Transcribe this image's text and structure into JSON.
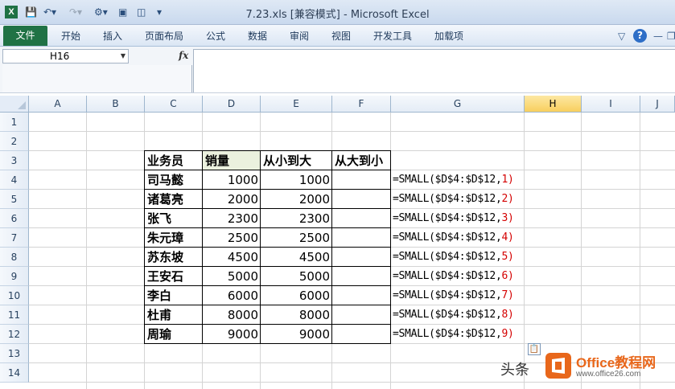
{
  "window": {
    "title": "7.23.xls  [兼容模式] - Microsoft Excel"
  },
  "ribbon": {
    "file_tab": "文件",
    "tabs": [
      "开始",
      "插入",
      "页面布局",
      "公式",
      "数据",
      "审阅",
      "视图",
      "开发工具",
      "加载项"
    ]
  },
  "formula_bar": {
    "name_box": "H16",
    "fx": "fx",
    "value": ""
  },
  "columns": [
    "A",
    "B",
    "C",
    "D",
    "E",
    "F",
    "G",
    "H",
    "I",
    "J"
  ],
  "active_column": "H",
  "rows": [
    "1",
    "2",
    "3",
    "4",
    "5",
    "6",
    "7",
    "8",
    "9",
    "10",
    "11",
    "12",
    "13",
    "14"
  ],
  "table": {
    "headers": [
      "业务员",
      "销量",
      "从小到大",
      "从大到小"
    ],
    "records": [
      {
        "name": "司马懿",
        "sales": "1000",
        "asc": "1000",
        "formula": "=SMALL($D$4:$D$12,",
        "arg": "1",
        "close": ")"
      },
      {
        "name": "诸葛亮",
        "sales": "2000",
        "asc": "2000",
        "formula": "=SMALL($D$4:$D$12,",
        "arg": "2",
        "close": ")"
      },
      {
        "name": "张飞",
        "sales": "2300",
        "asc": "2300",
        "formula": "=SMALL($D$4:$D$12,",
        "arg": "3",
        "close": ")"
      },
      {
        "name": "朱元璋",
        "sales": "2500",
        "asc": "2500",
        "formula": "=SMALL($D$4:$D$12,",
        "arg": "4",
        "close": ")"
      },
      {
        "name": "苏东坡",
        "sales": "4500",
        "asc": "4500",
        "formula": "=SMALL($D$4:$D$12,",
        "arg": "5",
        "close": ")"
      },
      {
        "name": "王安石",
        "sales": "5000",
        "asc": "5000",
        "formula": "=SMALL($D$4:$D$12,",
        "arg": "6",
        "close": ")"
      },
      {
        "name": "李白",
        "sales": "6000",
        "asc": "6000",
        "formula": "=SMALL($D$4:$D$12,",
        "arg": "7",
        "close": ")"
      },
      {
        "name": "杜甫",
        "sales": "8000",
        "asc": "8000",
        "formula": "=SMALL($D$4:$D$12,",
        "arg": "8",
        "close": ")"
      },
      {
        "name": "周瑜",
        "sales": "9000",
        "asc": "9000",
        "formula": "=SMALL($D$4:$D$12,",
        "arg": "9",
        "close": ")"
      }
    ]
  },
  "watermark": {
    "prefix": "头条",
    "brand": "Office教程网",
    "url": "www.office26.com"
  },
  "colors": {
    "file_tab": "#207245",
    "active_header": "#f8cf5e",
    "formula_arg": "#d40000",
    "brand": "#e8671b"
  }
}
